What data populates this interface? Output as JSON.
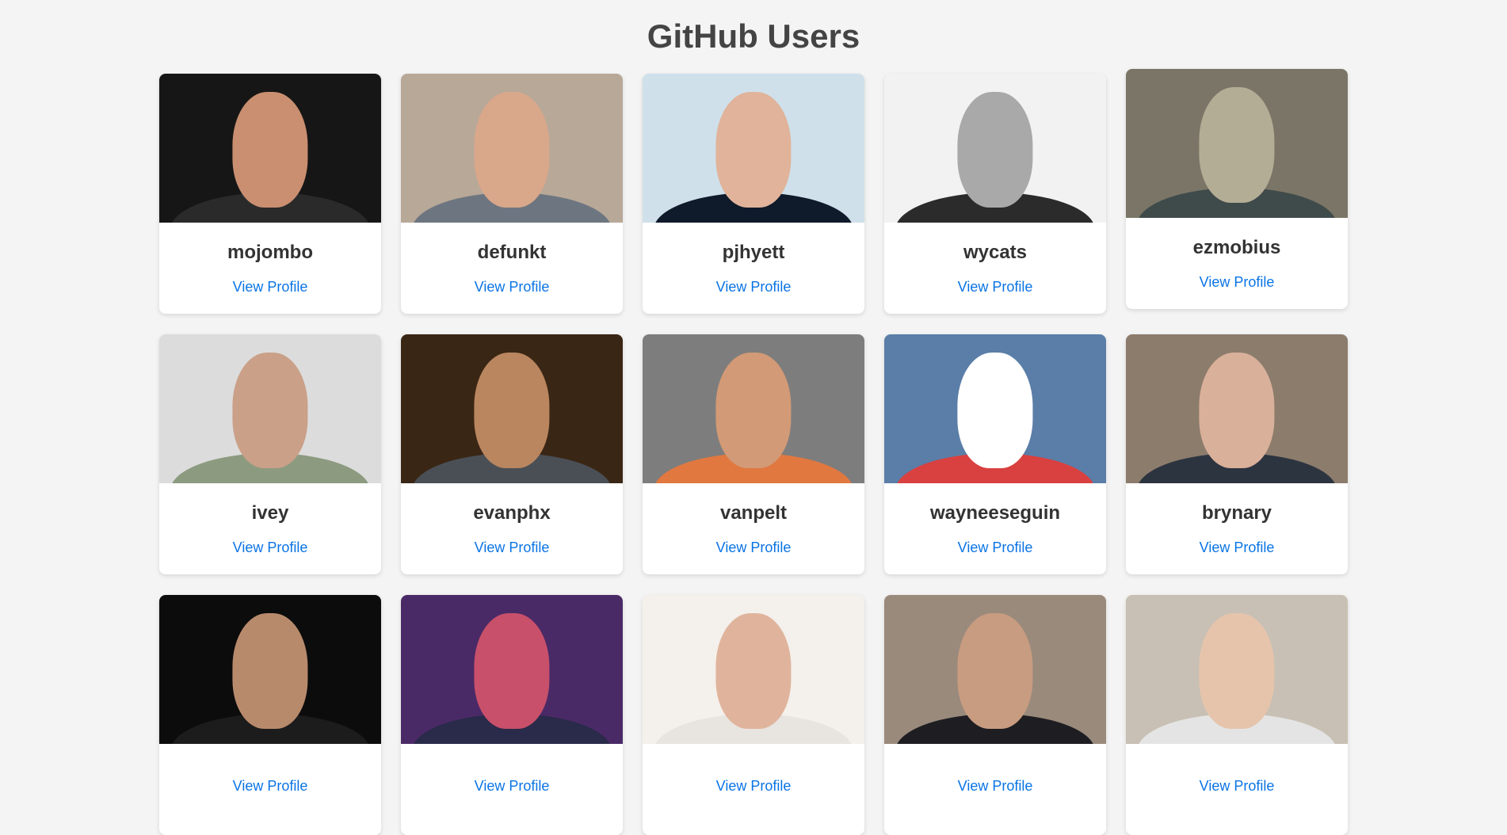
{
  "page": {
    "title": "GitHub Users"
  },
  "link_label": "View Profile",
  "users": [
    {
      "login": "mojombo",
      "bg": "#161616",
      "skin": "#c98f70",
      "shirt": "#2a2a2a"
    },
    {
      "login": "defunkt",
      "bg": "#b8a898",
      "skin": "#d9a78a",
      "shirt": "#6d7680"
    },
    {
      "login": "pjhyett",
      "bg": "#cfe0ea",
      "skin": "#e0b39a",
      "shirt": "#0f1a2a"
    },
    {
      "login": "wycats",
      "bg": "#f2f2f2",
      "skin": "#a9a9a9",
      "shirt": "#2b2b2b"
    },
    {
      "login": "ezmobius",
      "bg": "#7a7566",
      "skin": "#b4ad96",
      "shirt": "#3f4a4a"
    },
    {
      "login": "ivey",
      "bg": "#dcdcdc",
      "skin": "#caa088",
      "shirt": "#8c9b7f"
    },
    {
      "login": "evanphx",
      "bg": "#3a2614",
      "skin": "#b98660",
      "shirt": "#4a4f55"
    },
    {
      "login": "vanpelt",
      "bg": "#7d7d7d",
      "skin": "#d29a76",
      "shirt": "#e07840"
    },
    {
      "login": "wayneeseguin",
      "bg": "#5a7ea8",
      "skin": "#ffffff",
      "shirt": "#d94040"
    },
    {
      "login": "brynary",
      "bg": "#8c7c6c",
      "skin": "#d9b09a",
      "shirt": "#2c3440"
    },
    {
      "login": "",
      "bg": "#0c0c0c",
      "skin": "#b88a6c",
      "shirt": "#1c1c1c"
    },
    {
      "login": "",
      "bg": "#4a2a66",
      "skin": "#c8506a",
      "shirt": "#2a2a4a"
    },
    {
      "login": "",
      "bg": "#f4f0ec",
      "skin": "#e0b49c",
      "shirt": "#e8e4e0"
    },
    {
      "login": "",
      "bg": "#9a8a7c",
      "skin": "#c89c80",
      "shirt": "#1e1e22"
    },
    {
      "login": "",
      "bg": "#c8c0b4",
      "skin": "#e6c4ac",
      "shirt": "#e4e4e4"
    }
  ]
}
